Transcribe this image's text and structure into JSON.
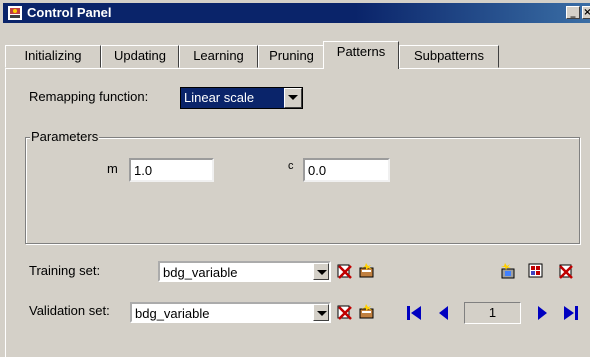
{
  "window": {
    "title": "Control Panel"
  },
  "tabs": [
    "Initializing",
    "Updating",
    "Learning",
    "Pruning",
    "Patterns",
    "Subpatterns"
  ],
  "active_tab": "Patterns",
  "remapping": {
    "label": "Remapping function:",
    "value": "Linear scale"
  },
  "parameters": {
    "title": "Parameters",
    "m_label": "m",
    "m_value": "1.0",
    "c_label": "c",
    "c_value": "0.0"
  },
  "training": {
    "label": "Training set:",
    "value": "bdg_variable"
  },
  "validation": {
    "label": "Validation set:",
    "value": "bdg_variable"
  },
  "pattern_index": "1",
  "colors": {
    "title_bar": "#0a246a",
    "selection": "#0a246a",
    "nav_blue": "#0000c0"
  }
}
